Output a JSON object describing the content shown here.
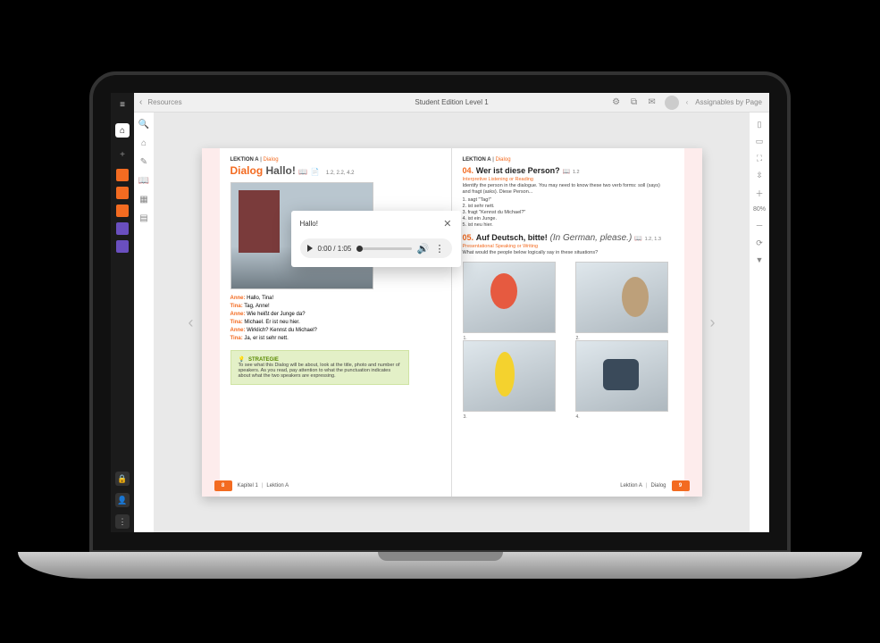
{
  "header": {
    "back_label": "Resources",
    "title": "Student Edition Level 1",
    "assignables": "Assignables by Page"
  },
  "sysbar": {
    "swatches": [
      "#f36b21",
      "#f36b21",
      "#f36b21",
      "#6a4fbf",
      "#6a4fbf"
    ]
  },
  "leftcol_icons": [
    "search-icon",
    "home-icon",
    "edit-icon",
    "read-icon",
    "grid-icon",
    "layers-icon"
  ],
  "rightcol": {
    "zoom": "80%"
  },
  "audio_popup": {
    "title": "Hallo!",
    "time": "0:00 / 1:05"
  },
  "left_page": {
    "crumb_a": "LEKTION A",
    "crumb_b": "Dialog",
    "title_a": "Dialog",
    "title_b": "Hallo!",
    "meta": "1.2, 2.2, 4.2",
    "dialog": [
      {
        "sp": "Anne:",
        "tx": "Hallo, Tina!"
      },
      {
        "sp": "Tina:",
        "tx": "Tag, Anne!"
      },
      {
        "sp": "Anne:",
        "tx": "Wie heißt der Junge da?"
      },
      {
        "sp": "Tina:",
        "tx": "Michael. Er ist neu hier."
      },
      {
        "sp": "Anne:",
        "tx": "Wirklich? Kennst du Michael?"
      },
      {
        "sp": "Tina:",
        "tx": "Ja, er ist sehr nett."
      }
    ],
    "tip_head": "STRATEGIE",
    "tip_body": "To see what this Dialog will be about, look at the title, photo and number of speakers. As you read, pay attention to what the punctuation indicates about what the two speakers are expressing.",
    "footer_num": "8",
    "footer_a": "Kapitel 1",
    "footer_b": "Lektion A"
  },
  "right_page": {
    "crumb_a": "LEKTION A",
    "crumb_b": "Dialog",
    "s04_num": "04.",
    "s04_title": "Wer ist diese Person?",
    "s04_meta": "1.2",
    "s04_sub": "Interpretive Listening or Reading",
    "s04_desc": "Identify the person in the dialogue. You may need to know these two verb forms: soll (says) and fragt (asks). Diese Person...",
    "s04_list": [
      "1.  sagt \"Tag!\"",
      "2.  ist sehr nett.",
      "3.  fragt \"Kennst du Michael?\"",
      "4.  ist ein Junge.",
      "5.  ist neu hier."
    ],
    "s05_num": "05.",
    "s05_title": "Auf Deutsch, bitte!",
    "s05_paren": "(In German, please.)",
    "s05_meta": "1.2, 1.3",
    "s05_sub": "Presentational Speaking or Writing",
    "s05_desc": "What would the people below logically say in these situations?",
    "captions": [
      "1.",
      "2.",
      "3.",
      "4."
    ],
    "footer_a": "Lektion A",
    "footer_b": "Dialog",
    "footer_num": "9"
  }
}
